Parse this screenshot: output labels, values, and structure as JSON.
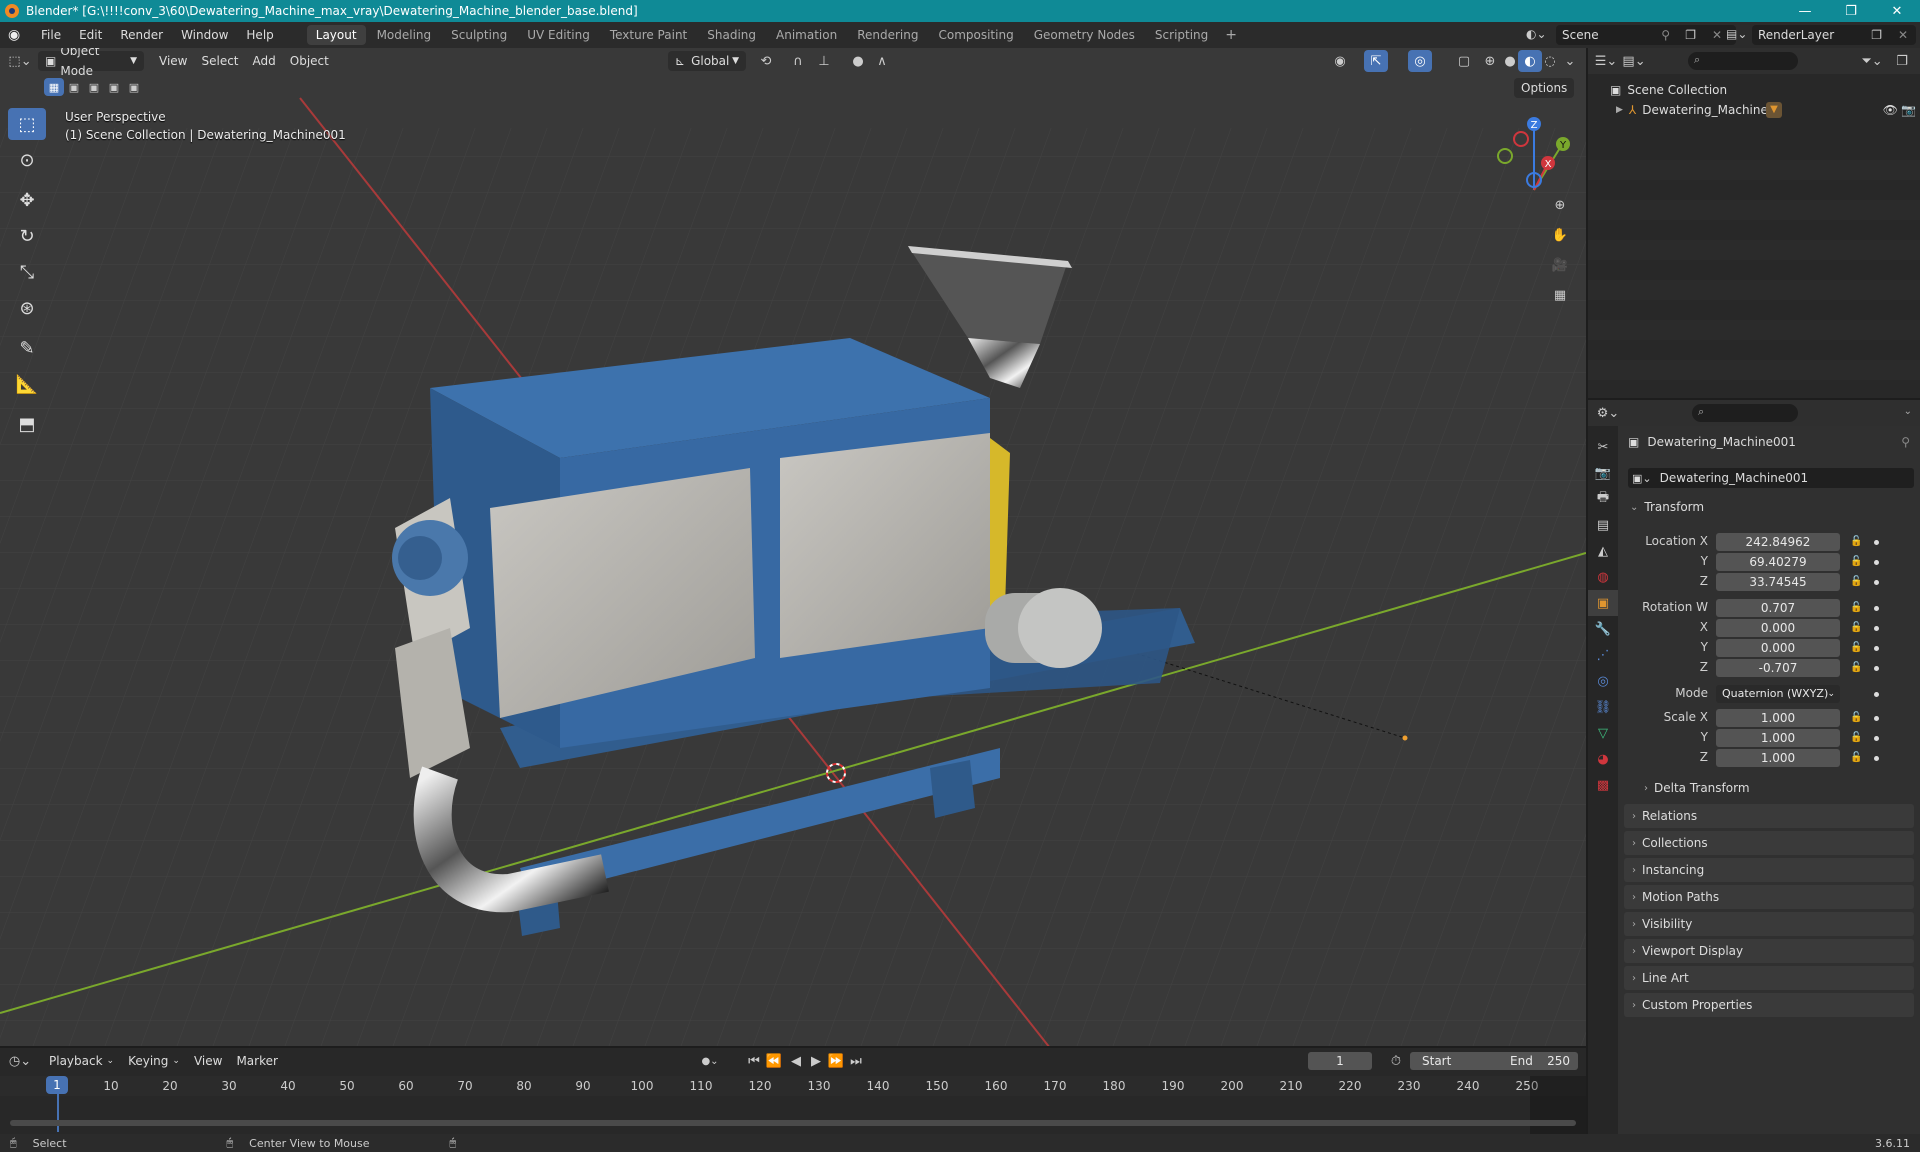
{
  "window": {
    "title": "Blender* [G:\\!!!!conv_3\\60\\Dewatering_Machine_max_vray\\Dewatering_Machine_blender_base.blend]",
    "minimize": "—",
    "maximize": "❐",
    "close": "✕"
  },
  "menu": {
    "items": [
      "File",
      "Edit",
      "Render",
      "Window",
      "Help"
    ],
    "workspaces": [
      "Layout",
      "Modeling",
      "Sculpting",
      "UV Editing",
      "Texture Paint",
      "Shading",
      "Animation",
      "Rendering",
      "Compositing",
      "Geometry Nodes",
      "Scripting"
    ],
    "active_workspace": "Layout",
    "add_workspace": "+",
    "scene": "Scene",
    "view_layer": "RenderLayer"
  },
  "viewport": {
    "mode": "Object Mode",
    "menus": [
      "View",
      "Select",
      "Add",
      "Object"
    ],
    "orientation": "Global",
    "options": "Options",
    "perspective": "User Perspective",
    "collection_info": "(1) Scene Collection | Dewatering_Machine001",
    "gizmo": {
      "x": "X",
      "y": "Y",
      "z": "Z"
    }
  },
  "outliner": {
    "root": "Scene Collection",
    "items": [
      {
        "name": "Dewatering_Machine"
      }
    ]
  },
  "properties": {
    "object_name": "Dewatering_Machine001",
    "datablock": "Dewatering_Machine001",
    "transform_title": "Transform",
    "location_label": "Location X",
    "location": {
      "x": "242.84962",
      "y": "69.40279",
      "z": "33.74545"
    },
    "rotation_label": "Rotation W",
    "rotation": {
      "w": "0.707",
      "x": "0.000",
      "y": "0.000",
      "z": "-0.707"
    },
    "mode_label": "Mode",
    "mode": "Quaternion (WXYZ)",
    "scale_label": "Scale X",
    "scale": {
      "x": "1.000",
      "y": "1.000",
      "z": "1.000"
    },
    "axis_labels": {
      "y": "Y",
      "z": "Z",
      "x": "X"
    },
    "delta": "Delta Transform",
    "panels": [
      "Relations",
      "Collections",
      "Instancing",
      "Motion Paths",
      "Visibility",
      "Viewport Display",
      "Line Art",
      "Custom Properties"
    ]
  },
  "timeline": {
    "menus": [
      "Playback",
      "Keying",
      "View",
      "Marker"
    ],
    "current_frame": "1",
    "start_label": "Start",
    "start": "1",
    "end_label": "End",
    "end": "250",
    "ticks": [
      "1",
      "10",
      "20",
      "30",
      "40",
      "50",
      "60",
      "70",
      "80",
      "90",
      "100",
      "110",
      "120",
      "130",
      "140",
      "150",
      "160",
      "170",
      "180",
      "190",
      "200",
      "210",
      "220",
      "230",
      "240",
      "250"
    ]
  },
  "status": {
    "select": "Select",
    "center": "Center View to Mouse",
    "version": "3.6.11"
  },
  "colors": {
    "accent": "#4772b3",
    "title_bar": "#0f8a96",
    "machine_blue": "#3b6ea8",
    "x_axis": "#a83a3a",
    "y_axis": "#7aa82c"
  }
}
